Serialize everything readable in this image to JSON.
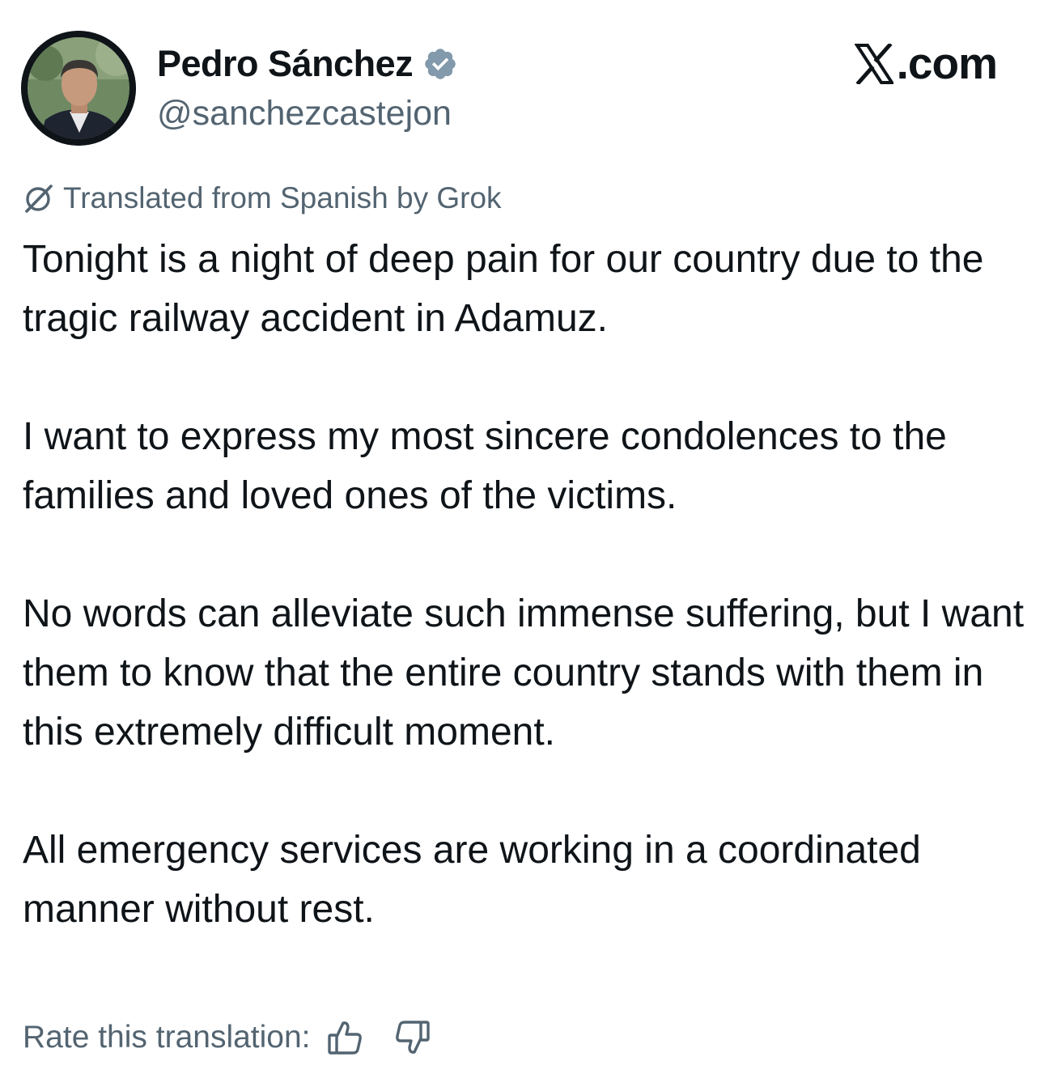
{
  "author": {
    "display_name": "Pedro Sánchez",
    "handle": "@sanchezcastejon",
    "verified": true,
    "verified_color": "#829aab",
    "avatar_icon": "profile-photo"
  },
  "site": {
    "label": ".com",
    "logo_icon": "x-logo"
  },
  "translation": {
    "notice": "Translated from Spanish by Grok",
    "notice_icon": "grok-icon",
    "rate_label": "Rate this translation:",
    "thumbs_up_icon": "thumbs-up-icon",
    "thumbs_down_icon": "thumbs-down-icon"
  },
  "tweet": {
    "paragraphs": [
      "Tonight is a night of deep pain for our country due to the tragic railway accident in Adamuz.",
      "I want to express my most sincere condolences to the families and loved ones of the victims.",
      "No words can alleviate such immense suffering, but I want them to know that the entire country stands with them in this extremely difficult moment.",
      "All emergency services are working in a coordinated manner without rest."
    ]
  },
  "colors": {
    "text_primary": "#0f1419",
    "text_secondary": "#536471",
    "background": "#ffffff"
  }
}
